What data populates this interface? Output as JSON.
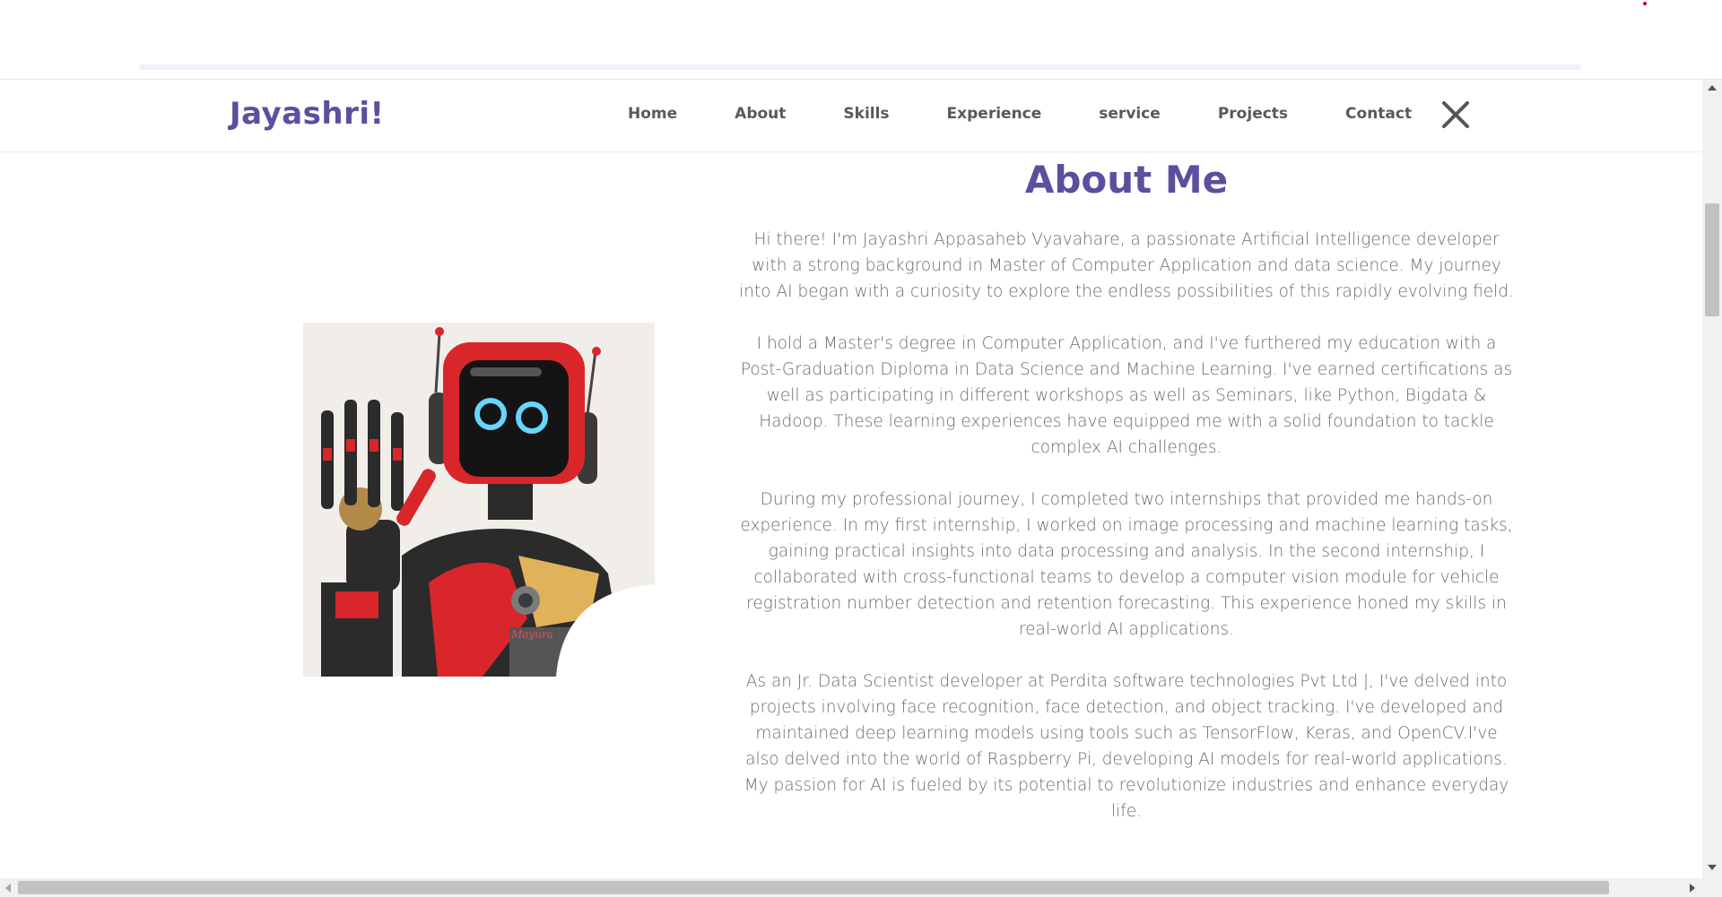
{
  "navbar": {
    "brand": "Jayashri!",
    "items": [
      {
        "label": "Home"
      },
      {
        "label": "About"
      },
      {
        "label": "Skills"
      },
      {
        "label": "Experience"
      },
      {
        "label": "service"
      },
      {
        "label": "Projects"
      },
      {
        "label": "Contact"
      }
    ],
    "close_icon": "close-icon"
  },
  "about": {
    "title": "About Me",
    "paragraphs": [
      "Hi there! I'm Jayashri Appasaheb Vyavahare, a passionate Artificial Intelligence developer with a strong background in Master of Computer Application and data science. My journey into AI began with a curiosity to explore the endless possibilities of this rapidly evolving field.",
      "I hold a Master's degree in Computer Application, and I've furthered my education with a Post-Graduation Diploma in Data Science and Machine Learning. I've earned certifications as well as participating in different workshops as well as Seminars, like Python, Bigdata & Hadoop. These learning experiences have equipped me with a solid foundation to tackle complex AI challenges.",
      "During my professional journey, I completed two internships that provided me hands-on experience. In my first internship, I worked on image processing and machine learning tasks, gaining practical insights into data processing and analysis. In the second internship, I collaborated with cross-functional teams to develop a computer vision module for vehicle registration number detection and retention forecasting. This experience honed my skills in real-world AI applications.",
      "As an Jr. Data Scientist developer at Perdita software technologies Pvt Ltd |, I've delved into projects involving face recognition, face detection, and object tracking. I've developed and maintained deep learning models using tools such as TensorFlow, Keras, and OpenCV.I've also delved into the world of Raspberry Pi, developing AI models for real-world applications. My passion for AI is fueled by its potential to revolutionize industries and enhance everyday life."
    ],
    "image": {
      "subject": "waving robot illustration",
      "watermark": "Mayura"
    }
  },
  "colors": {
    "brand": "#5b4f9e",
    "nav_text": "#58595b",
    "body_text": "#6b6b6b",
    "robot_red": "#d8262a"
  }
}
